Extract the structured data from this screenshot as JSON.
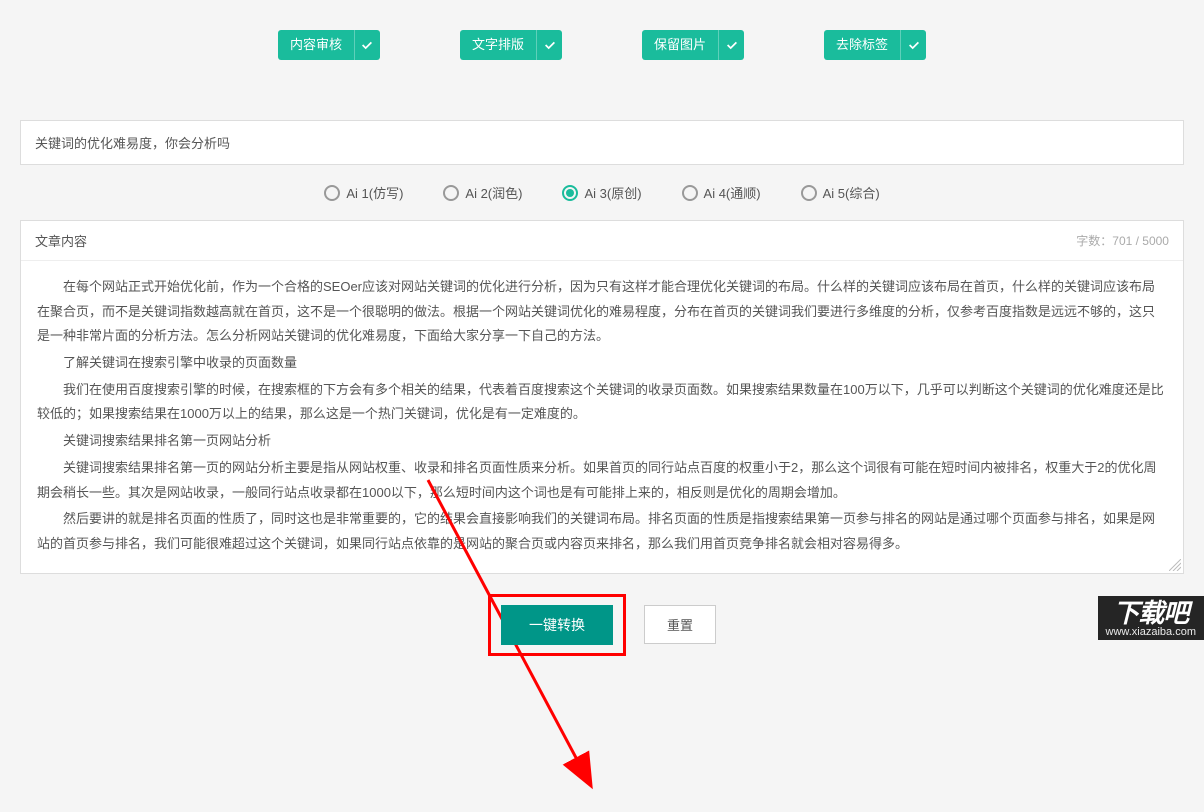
{
  "options": {
    "review": "内容审核",
    "format": "文字排版",
    "keepImg": "保留图片",
    "removeTag": "去除标签"
  },
  "titleInput": "关键词的优化难易度，你会分析吗",
  "aiOptions": [
    {
      "label": "Ai 1(仿写)",
      "selected": false
    },
    {
      "label": "Ai 2(润色)",
      "selected": false
    },
    {
      "label": "Ai 3(原创)",
      "selected": true
    },
    {
      "label": "Ai 4(通顺)",
      "selected": false
    },
    {
      "label": "Ai 5(综合)",
      "selected": false
    }
  ],
  "contentPanel": {
    "title": "文章内容",
    "countLabel": "字数：701 / 5000",
    "paragraphs": [
      "在每个网站正式开始优化前，作为一个合格的SEOer应该对网站关键词的优化进行分析，因为只有这样才能合理优化关键词的布局。什么样的关键词应该布局在首页，什么样的关键词应该布局在聚合页，而不是关键词指数越高就在首页，这不是一个很聪明的做法。根据一个网站关键词优化的难易程度，分布在首页的关键词我们要进行多维度的分析，仅参考百度指数是远远不够的，这只是一种非常片面的分析方法。怎么分析网站关键词的优化难易度，下面给大家分享一下自己的方法。",
      "了解关键词在搜索引擎中收录的页面数量",
      "我们在使用百度搜索引擎的时候，在搜索框的下方会有多个相关的结果，代表着百度搜索这个关键词的收录页面数。如果搜索结果数量在100万以下，几乎可以判断这个关键词的优化难度还是比较低的；如果搜索结果在1000万以上的结果，那么这是一个热门关键词，优化是有一定难度的。",
      "关键词搜索结果排名第一页网站分析",
      "关键词搜索结果排名第一页的网站分析主要是指从网站权重、收录和排名页面性质来分析。如果首页的同行站点百度的权重小于2，那么这个词很有可能在短时间内被排名，权重大于2的优化周期会稍长一些。其次是网站收录，一般同行站点收录都在1000以下，那么短时间内这个词也是有可能排上来的，相反则是优化的周期会增加。",
      "然后要讲的就是排名页面的性质了，同时这也是非常重要的，它的结果会直接影响我们的关键词布局。排名页面的性质是指搜索结果第一页参与排名的网站是通过哪个页面参与排名，如果是网站的首页参与排名，我们可能很难超过这个关键词，如果同行站点依靠的是网站的聚合页或内容页来排名，那么我们用首页竞争排名就会相对容易得多。"
    ]
  },
  "actions": {
    "convert": "一键转换",
    "reset": "重置"
  },
  "watermark": {
    "brand": "下载吧",
    "url": "www.xiazaiba.com"
  }
}
